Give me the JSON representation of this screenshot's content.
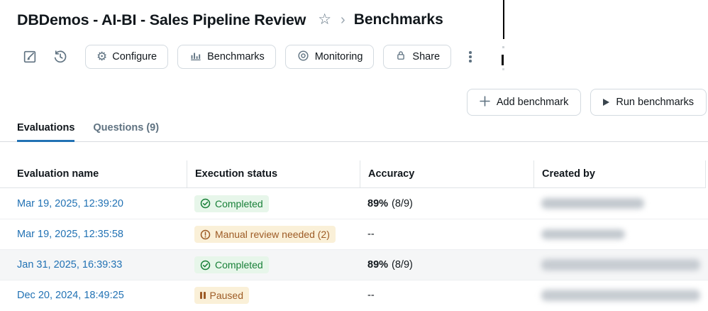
{
  "header": {
    "title": "DBDemos - AI-BI - Sales Pipeline Review",
    "breadcrumb_current": "Benchmarks"
  },
  "icons": {
    "star": "☆",
    "breadcrumb_chevron": "›",
    "gear": "⚙"
  },
  "toolbar": {
    "configure": "Configure",
    "benchmarks": "Benchmarks",
    "monitoring": "Monitoring",
    "share": "Share"
  },
  "actions": {
    "add_benchmark": "Add benchmark",
    "run_benchmarks": "Run benchmarks"
  },
  "tabs": {
    "evaluations": "Evaluations",
    "questions": "Questions (9)"
  },
  "table": {
    "headers": {
      "name": "Evaluation name",
      "status": "Execution status",
      "accuracy": "Accuracy",
      "created_by": "Created by"
    },
    "rows": [
      {
        "name": "Mar 19, 2025, 12:39:20",
        "status": "Completed",
        "status_type": "success",
        "accuracy_bold": "89%",
        "accuracy_detail": "(8/9)",
        "created_by_redacted": true
      },
      {
        "name": "Mar 19, 2025, 12:35:58",
        "status": "Manual review needed (2)",
        "status_type": "warning",
        "accuracy_plain": "--",
        "created_by_redacted": true
      },
      {
        "name": "Jan 31, 2025, 16:39:33",
        "status": "Completed",
        "status_type": "success",
        "accuracy_bold": "89%",
        "accuracy_detail": "(8/9)",
        "created_by_redacted": true
      },
      {
        "name": "Dec 20, 2024, 18:49:25",
        "status": "Paused",
        "status_type": "paused",
        "accuracy_plain": "--",
        "created_by_redacted": true
      }
    ]
  },
  "colors": {
    "link_blue": "#2272B4",
    "tab_accent": "#2272B4",
    "success_bg": "#E7F6EA",
    "success_text": "#188038",
    "warning_bg": "#FAF0D8",
    "warning_text": "#9D5B25",
    "icon_slate": "#5F7281",
    "text_dark": "#11171C"
  }
}
